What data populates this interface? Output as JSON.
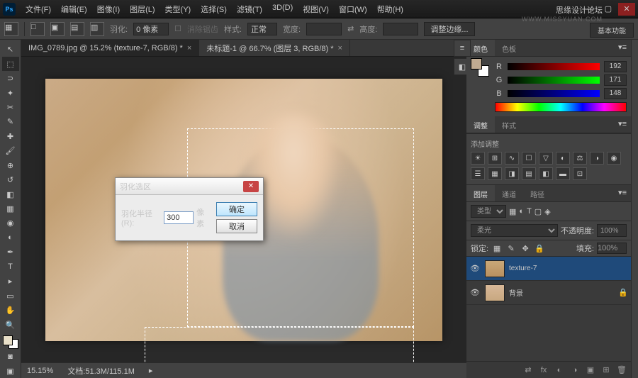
{
  "watermark": {
    "line1": "思缘设计论坛",
    "line2": "WWW.MISSYUAN.COM"
  },
  "menu": [
    "文件(F)",
    "编辑(E)",
    "图像(I)",
    "图层(L)",
    "类型(Y)",
    "选择(S)",
    "滤镜(T)",
    "3D(D)",
    "视图(V)",
    "窗口(W)",
    "帮助(H)"
  ],
  "workspace_label": "基本功能",
  "optionbar": {
    "feather_lbl": "羽化:",
    "feather_val": "0 像素",
    "antialias": "消除锯齿",
    "style_lbl": "样式:",
    "style_val": "正常",
    "width_lbl": "宽度:",
    "height_lbl": "高度:",
    "refine": "调整边缘..."
  },
  "tabs": [
    {
      "label": "IMG_0789.jpg @ 15.2% (texture-7, RGB/8) *",
      "active": true
    },
    {
      "label": "未标题-1 @ 66.7% (图层 3, RGB/8) *",
      "active": false
    }
  ],
  "status": {
    "zoom": "15.15%",
    "doc": "文档:51.3M/115.1M"
  },
  "color_panel": {
    "tabs": [
      "颜色",
      "色板"
    ],
    "r": "192",
    "g": "171",
    "b": "148"
  },
  "adj_panel": {
    "tabs": [
      "调整",
      "样式"
    ],
    "title": "添加调整"
  },
  "layers_panel": {
    "tabs": [
      "图层",
      "通道",
      "路径"
    ],
    "kind": "类型",
    "blend": "柔光",
    "opacity_lbl": "不透明度:",
    "opacity": "100%",
    "lock_lbl": "锁定:",
    "fill_lbl": "填充:",
    "fill": "100%",
    "layers": [
      {
        "name": "texture-7",
        "selected": true,
        "visible": true,
        "locked": false
      },
      {
        "name": "背景",
        "selected": false,
        "visible": true,
        "locked": true
      }
    ]
  },
  "dialog": {
    "title": "羽化选区",
    "radius_lbl": "羽化半径(R):",
    "radius_val": "300",
    "unit": "像素",
    "ok": "确定",
    "cancel": "取消"
  }
}
